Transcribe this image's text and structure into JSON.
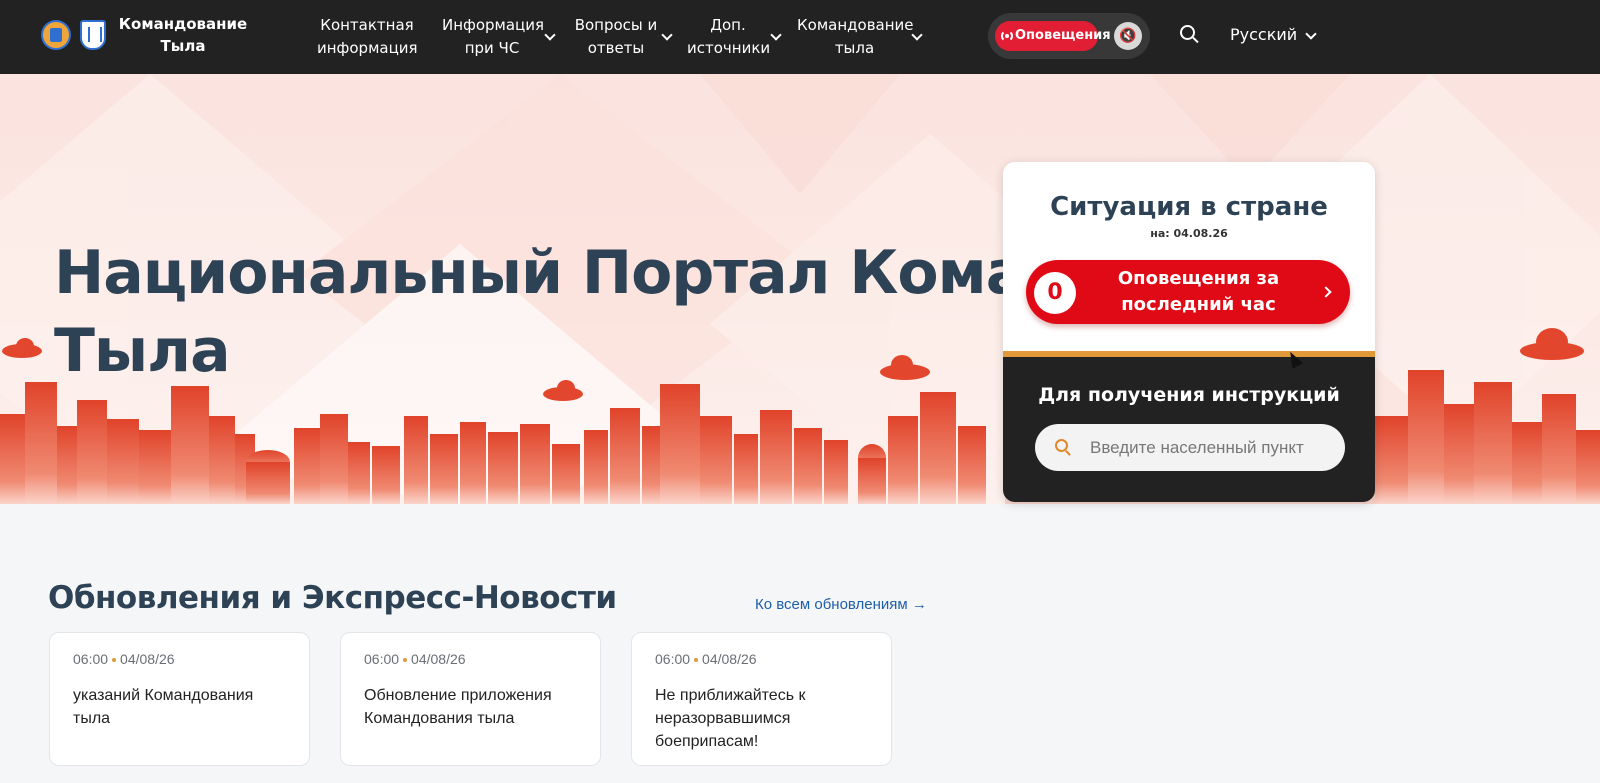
{
  "header": {
    "brand_line1": "Командование",
    "brand_line2": "Тыла",
    "nav": [
      {
        "line1": "Контактная",
        "line2": "информация"
      },
      {
        "line1": "Информация",
        "line2": "при ЧС"
      },
      {
        "line1": "Вопросы и",
        "line2": "ответы"
      },
      {
        "line1": "Доп.",
        "line2": "источники"
      },
      {
        "line1": "Командование",
        "line2": "тыла"
      }
    ],
    "alerts_label": "Оповещения",
    "language": "Русский"
  },
  "hero": {
    "title_line1": "Национальный Портал Командования",
    "title_line2": "Тыла"
  },
  "situation": {
    "title": "Ситуация в стране",
    "date": "на: 04.08.26",
    "alert_count": "0",
    "alert_label_line1": "Оповещения за",
    "alert_label_line2": "последний час",
    "instructions_title": "Для получения инструкций",
    "search_placeholder": "Введите населенный пункт"
  },
  "updates": {
    "title": "Обновления и Экспресс-Новости",
    "all_link": "Ко всем обновлениям →",
    "cards": [
      {
        "time": "06:00",
        "date": "04/08/26",
        "text": "указаний Командования тыла"
      },
      {
        "time": "06:00",
        "date": "04/08/26",
        "text": "Обновление приложения Командования тыла"
      },
      {
        "time": "06:00",
        "date": "04/08/26",
        "text": "Не приближайтесь к неразорвавшимся боеприпасам!"
      }
    ]
  },
  "colors": {
    "header_bg": "#222222",
    "alert_red": "#e00a16",
    "title_navy": "#2e4256",
    "accent_orange": "#e09a3a",
    "link_blue": "#1f5fa8"
  },
  "icons": [
    "logo-emblem-icon",
    "state-emblem-icon",
    "chevron-down-icon",
    "broadcast-icon",
    "mute-icon",
    "search-icon",
    "chevron-right-icon"
  ]
}
